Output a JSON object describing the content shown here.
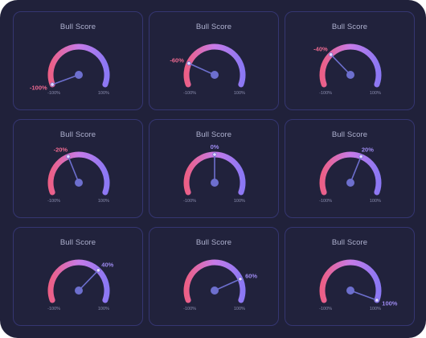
{
  "widget": {
    "title": "Bull Score",
    "min_label": "-100%",
    "max_label": "100%"
  },
  "colors": {
    "background": "#20213a",
    "card_border": "#353671",
    "arc_start": "#ec5f86",
    "arc_mid": "#c77be8",
    "arc_end": "#8b78f4",
    "needle": "#6d6fce",
    "label_low": "#ee6a91",
    "label_high": "#9d8af0"
  },
  "gauges": [
    {
      "title": "Bull Score",
      "value": -100,
      "value_label": "-100%"
    },
    {
      "title": "Bull Score",
      "value": -60,
      "value_label": "-60%"
    },
    {
      "title": "Bull Score",
      "value": -40,
      "value_label": "-40%"
    },
    {
      "title": "Bull Score",
      "value": -20,
      "value_label": "-20%"
    },
    {
      "title": "Bull Score",
      "value": 0,
      "value_label": "0%"
    },
    {
      "title": "Bull Score",
      "value": 20,
      "value_label": "20%"
    },
    {
      "title": "Bull Score",
      "value": 40,
      "value_label": "40%"
    },
    {
      "title": "Bull Score",
      "value": 60,
      "value_label": "60%"
    },
    {
      "title": "Bull Score",
      "value": 100,
      "value_label": "100%"
    }
  ]
}
